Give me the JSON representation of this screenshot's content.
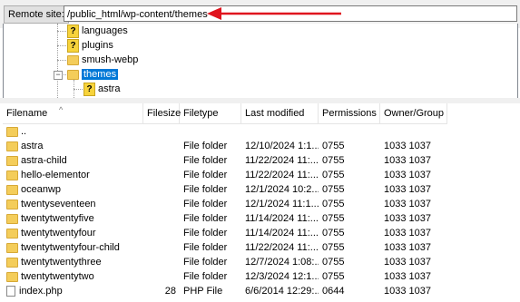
{
  "remote_site": {
    "label": "Remote site:",
    "path": "/public_html/wp-content/themes"
  },
  "tree": {
    "items": [
      {
        "label": "languages",
        "icon": "question-folder-icon"
      },
      {
        "label": "plugins",
        "icon": "question-folder-icon"
      },
      {
        "label": "smush-webp",
        "icon": "folder-icon"
      },
      {
        "label": "themes",
        "icon": "folder-icon",
        "selected": true,
        "expanded": true
      },
      {
        "label": "astra",
        "icon": "question-folder-icon"
      }
    ],
    "collapse_glyph": "−"
  },
  "file_list": {
    "columns": [
      "Filename",
      "Filesize",
      "Filetype",
      "Last modified",
      "Permissions",
      "Owner/Group"
    ],
    "sort_caret": "^",
    "rows": [
      {
        "name": "..",
        "size": "",
        "type": "",
        "modified": "",
        "perms": "",
        "owner": "",
        "icon": "folder-icon"
      },
      {
        "name": "astra",
        "size": "",
        "type": "File folder",
        "modified": "12/10/2024 1:1...",
        "perms": "0755",
        "owner": "1033 1037",
        "icon": "folder-icon"
      },
      {
        "name": "astra-child",
        "size": "",
        "type": "File folder",
        "modified": "11/22/2024 11:...",
        "perms": "0755",
        "owner": "1033 1037",
        "icon": "folder-icon"
      },
      {
        "name": "hello-elementor",
        "size": "",
        "type": "File folder",
        "modified": "11/22/2024 11:...",
        "perms": "0755",
        "owner": "1033 1037",
        "icon": "folder-icon"
      },
      {
        "name": "oceanwp",
        "size": "",
        "type": "File folder",
        "modified": "12/1/2024 10:2...",
        "perms": "0755",
        "owner": "1033 1037",
        "icon": "folder-icon"
      },
      {
        "name": "twentyseventeen",
        "size": "",
        "type": "File folder",
        "modified": "12/1/2024 11:1...",
        "perms": "0755",
        "owner": "1033 1037",
        "icon": "folder-icon"
      },
      {
        "name": "twentytwentyfive",
        "size": "",
        "type": "File folder",
        "modified": "11/14/2024 11:...",
        "perms": "0755",
        "owner": "1033 1037",
        "icon": "folder-icon"
      },
      {
        "name": "twentytwentyfour",
        "size": "",
        "type": "File folder",
        "modified": "11/14/2024 11:...",
        "perms": "0755",
        "owner": "1033 1037",
        "icon": "folder-icon"
      },
      {
        "name": "twentytwentyfour-child",
        "size": "",
        "type": "File folder",
        "modified": "11/22/2024 11:...",
        "perms": "0755",
        "owner": "1033 1037",
        "icon": "folder-icon"
      },
      {
        "name": "twentytwentythree",
        "size": "",
        "type": "File folder",
        "modified": "12/7/2024 1:08:...",
        "perms": "0755",
        "owner": "1033 1037",
        "icon": "folder-icon"
      },
      {
        "name": "twentytwentytwo",
        "size": "",
        "type": "File folder",
        "modified": "12/3/2024 12:1...",
        "perms": "0755",
        "owner": "1033 1037",
        "icon": "folder-icon"
      },
      {
        "name": "index.php",
        "size": "28",
        "type": "PHP File",
        "modified": "6/6/2014 12:29:...",
        "perms": "0644",
        "owner": "1033 1037",
        "icon": "file-icon"
      }
    ]
  },
  "colors": {
    "selection": "#0078d7",
    "arrow": "#e0141e",
    "folder": "#f4cd5a"
  }
}
